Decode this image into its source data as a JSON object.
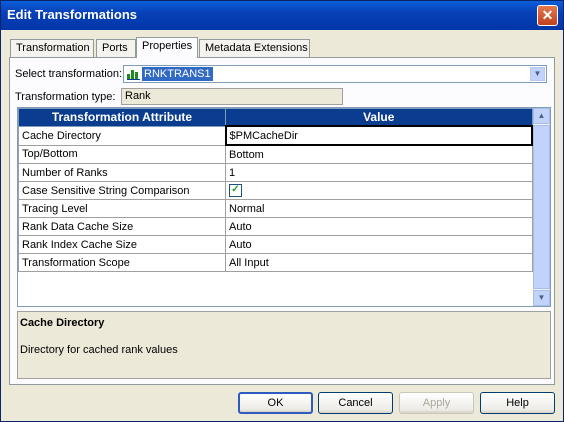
{
  "window": {
    "title": "Edit Transformations",
    "close_glyph": "✕"
  },
  "tabs": [
    {
      "label": "Transformation"
    },
    {
      "label": "Ports"
    },
    {
      "label": "Properties"
    },
    {
      "label": "Metadata Extensions"
    }
  ],
  "active_tab": "Properties",
  "select_transformation": {
    "label": "Select transformation:",
    "value": "RNKTRANS1",
    "icon": "rank-transformation-icon"
  },
  "transformation_type": {
    "label": "Transformation type:",
    "value": "Rank"
  },
  "grid": {
    "headers": [
      "Transformation Attribute",
      "Value"
    ],
    "rows": [
      {
        "attribute": "Cache Directory",
        "value": "$PMCacheDir"
      },
      {
        "attribute": "Top/Bottom",
        "value": "Bottom"
      },
      {
        "attribute": "Number of Ranks",
        "value": "1"
      },
      {
        "attribute": "Case Sensitive String Comparison",
        "value": "",
        "checked": true
      },
      {
        "attribute": "Tracing Level",
        "value": "Normal"
      },
      {
        "attribute": "Rank Data Cache Size",
        "value": "Auto"
      },
      {
        "attribute": "Rank Index Cache Size",
        "value": "Auto"
      },
      {
        "attribute": "Transformation Scope",
        "value": "All Input"
      }
    ],
    "selected_row": 0
  },
  "description": {
    "title": "Cache Directory",
    "text": "Directory for cached rank values"
  },
  "buttons": {
    "ok": "OK",
    "cancel": "Cancel",
    "apply": "Apply",
    "help": "Help"
  },
  "colors": {
    "title_bar": "#0A46C8",
    "grid_header": "#0A3D8F",
    "selection": "#316AC5"
  }
}
